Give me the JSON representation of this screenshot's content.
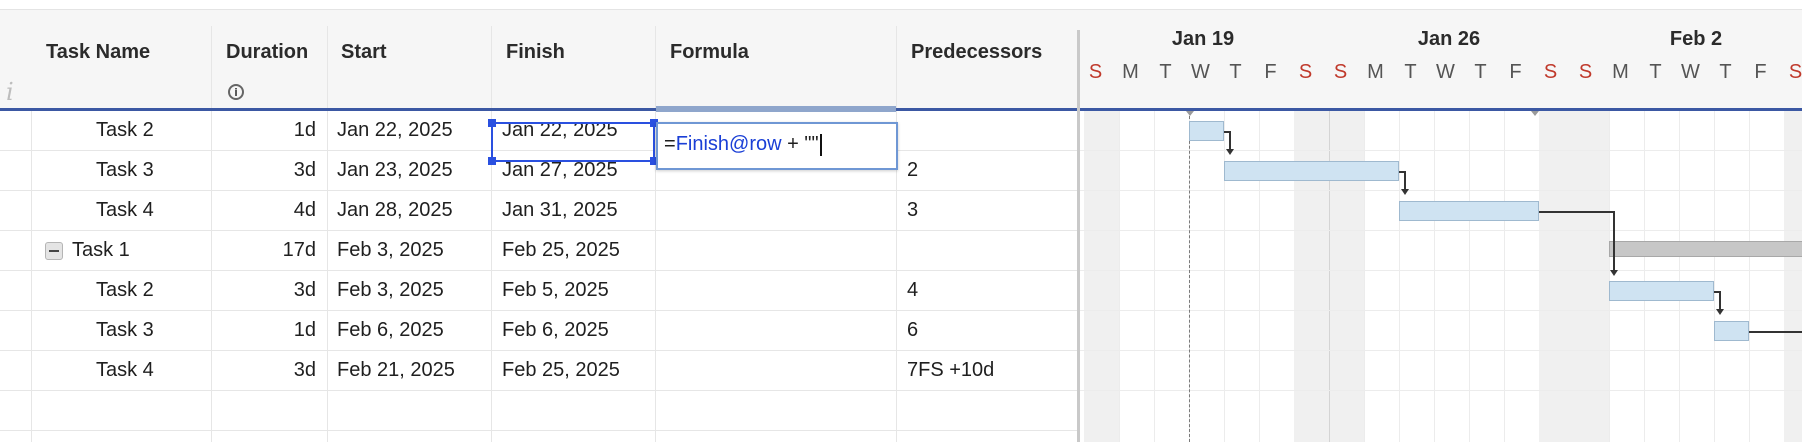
{
  "grid": {
    "info_letter": "i",
    "columns": {
      "task_name": "Task Name",
      "duration": "Duration",
      "start": "Start",
      "finish": "Finish",
      "formula": "Formula",
      "predecessors": "Predecessors"
    },
    "rows": [
      {
        "task": "Task 2",
        "duration": "1d",
        "start": "Jan 22, 2025",
        "finish": "Jan 22, 2025",
        "predecessors": ""
      },
      {
        "task": "Task 3",
        "duration": "3d",
        "start": "Jan 23, 2025",
        "finish": "Jan 27, 2025",
        "predecessors": "2"
      },
      {
        "task": "Task 4",
        "duration": "4d",
        "start": "Jan 28, 2025",
        "finish": "Jan 31, 2025",
        "predecessors": "3"
      },
      {
        "task": "Task 1",
        "duration": "17d",
        "start": "Feb 3, 2025",
        "finish": "Feb 25, 2025",
        "predecessors": ""
      },
      {
        "task": "Task 2",
        "duration": "3d",
        "start": "Feb 3, 2025",
        "finish": "Feb 5, 2025",
        "predecessors": "4"
      },
      {
        "task": "Task 3",
        "duration": "1d",
        "start": "Feb 6, 2025",
        "finish": "Feb 6, 2025",
        "predecessors": "6"
      },
      {
        "task": "Task 4",
        "duration": "3d",
        "start": "Feb 21, 2025",
        "finish": "Feb 25, 2025",
        "predecessors": "7FS +10d"
      }
    ],
    "formula_editor": {
      "prefix": "=",
      "reference": "Finish@row",
      "suffix": " + \"\""
    }
  },
  "gantt": {
    "weeks": [
      "Jan 19",
      "Jan 26",
      "Feb 2"
    ],
    "days": [
      "S",
      "M",
      "T",
      "W",
      "T",
      "F",
      "S",
      "S",
      "M",
      "T",
      "W",
      "T",
      "F",
      "S",
      "S",
      "M",
      "T",
      "W",
      "T",
      "F",
      "S"
    ]
  }
}
